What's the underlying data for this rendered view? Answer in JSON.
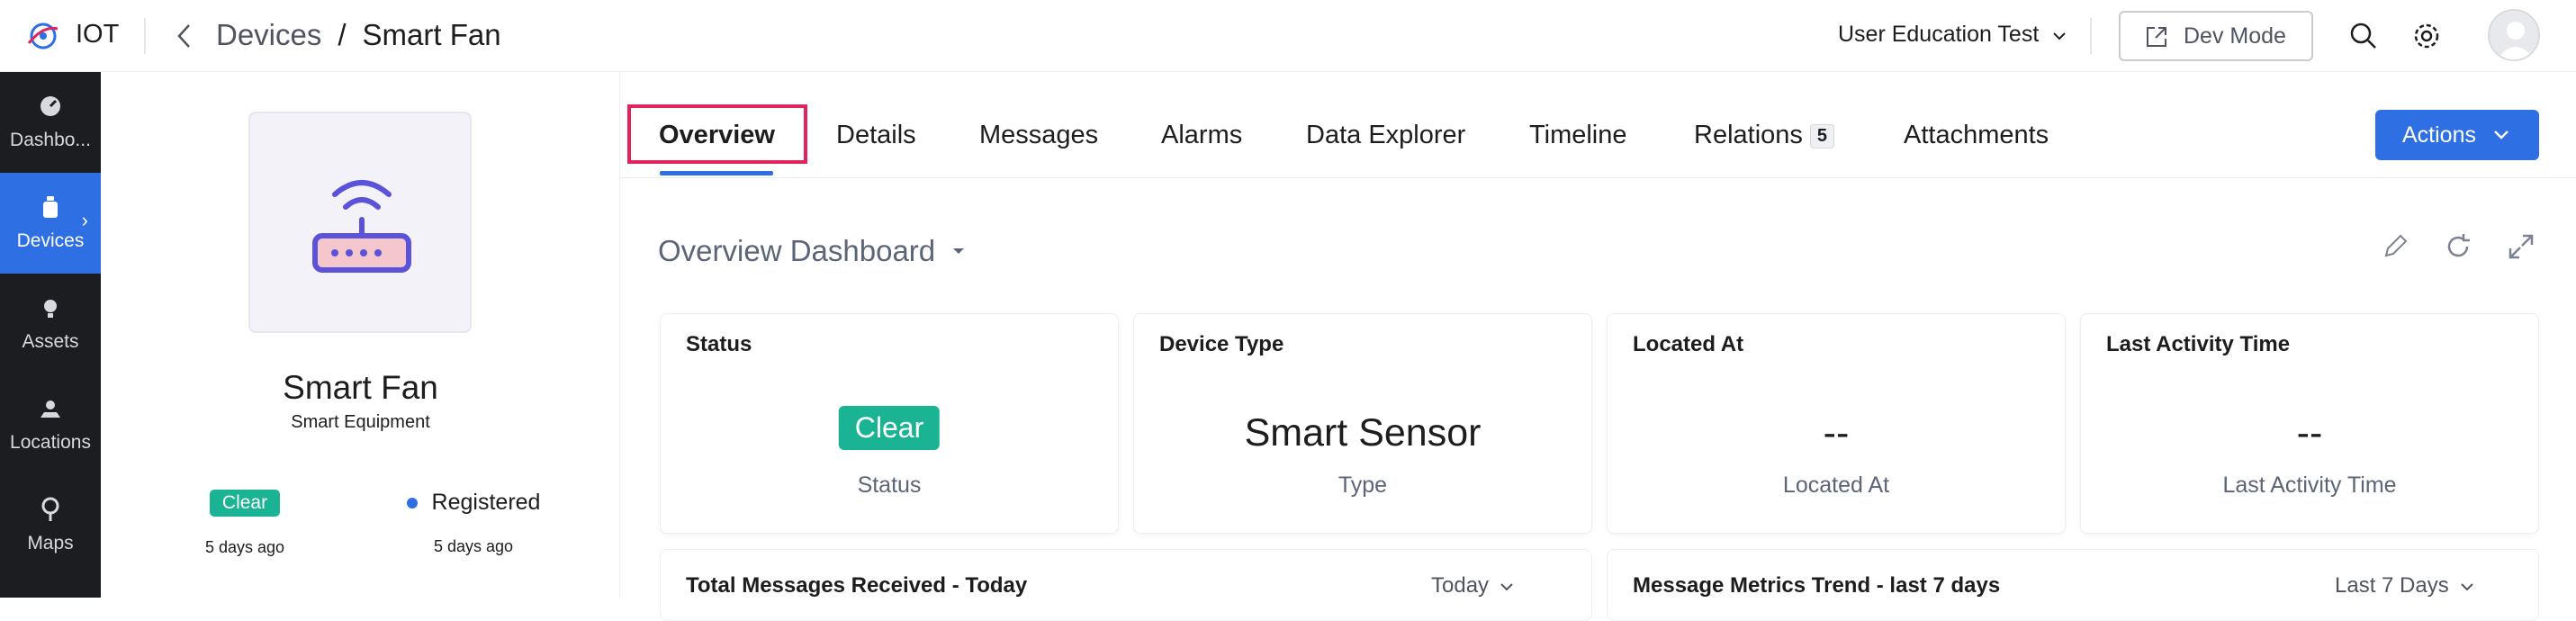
{
  "app": {
    "name": "IOT"
  },
  "breadcrumb": {
    "parent": "Devices",
    "separator": "/",
    "current": "Smart Fan"
  },
  "header": {
    "org": "User Education Test",
    "dev_mode": "Dev Mode"
  },
  "sidebar": {
    "items": [
      {
        "label": "Dashbo...",
        "icon": "dashboard-icon",
        "active": false
      },
      {
        "label": "Devices",
        "icon": "device-icon",
        "active": true
      },
      {
        "label": "Assets",
        "icon": "asset-icon",
        "active": false
      },
      {
        "label": "Locations",
        "icon": "location-icon",
        "active": false
      },
      {
        "label": "Maps",
        "icon": "map-pin-icon",
        "active": false
      }
    ]
  },
  "device": {
    "name": "Smart Fan",
    "type": "Smart Equipment",
    "status": "Clear",
    "status_time": "5 days ago",
    "registration": "Registered",
    "registration_time": "5 days ago",
    "icon": "router-icon"
  },
  "tabs": [
    {
      "label": "Overview",
      "active": true
    },
    {
      "label": "Details"
    },
    {
      "label": "Messages"
    },
    {
      "label": "Alarms"
    },
    {
      "label": "Data Explorer"
    },
    {
      "label": "Timeline"
    },
    {
      "label": "Relations",
      "count": "5"
    },
    {
      "label": "Attachments"
    }
  ],
  "actions_label": "Actions",
  "dashboard": {
    "title": "Overview Dashboard"
  },
  "cards": [
    {
      "title": "Status",
      "badge": "Clear",
      "sub": "Status"
    },
    {
      "title": "Device Type",
      "value": "Smart Sensor",
      "sub": "Type"
    },
    {
      "title": "Located At",
      "value": "--",
      "sub": "Located At"
    },
    {
      "title": "Last Activity Time",
      "value": "--",
      "sub": "Last Activity Time"
    }
  ],
  "widgets": [
    {
      "title": "Total Messages Received - Today",
      "range": "Today"
    },
    {
      "title": "Message Metrics Trend - last 7 days",
      "range": "Last 7 Days"
    }
  ],
  "colors": {
    "accent": "#2f6fe4",
    "success": "#1ab394",
    "highlight": "#e0245e",
    "sidebar": "#1b1d21"
  }
}
